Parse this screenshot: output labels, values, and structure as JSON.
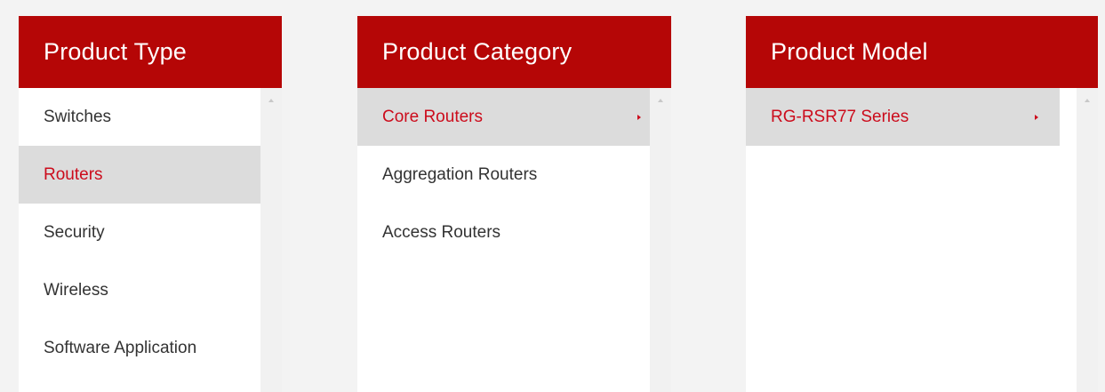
{
  "colors": {
    "header_bg": "#b50606",
    "header_text": "#ffffff",
    "active_text": "#cc0c1c",
    "active_bg": "#dcdcdc",
    "item_text": "#333333"
  },
  "panels": [
    {
      "title": "Product Type",
      "items": [
        {
          "label": "Switches",
          "selected": false
        },
        {
          "label": "Routers",
          "selected": true
        },
        {
          "label": "Security",
          "selected": false
        },
        {
          "label": "Wireless",
          "selected": false
        },
        {
          "label": "Software Application",
          "selected": false
        }
      ]
    },
    {
      "title": "Product Category",
      "items": [
        {
          "label": "Core Routers",
          "selected": true,
          "has_submenu": true
        },
        {
          "label": "Aggregation Routers",
          "selected": false
        },
        {
          "label": "Access Routers",
          "selected": false
        }
      ]
    },
    {
      "title": "Product Model",
      "items": [
        {
          "label": "RG-RSR77 Series",
          "selected": true,
          "has_submenu": true
        }
      ]
    }
  ]
}
